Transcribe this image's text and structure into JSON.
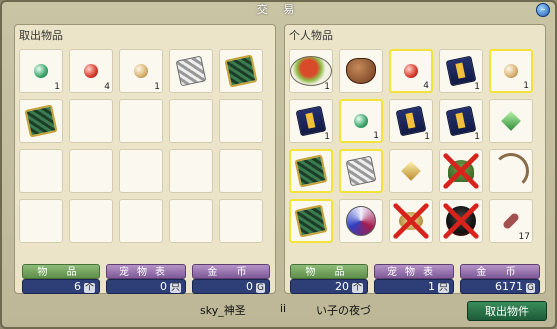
{
  "window": {
    "title": "交 易"
  },
  "left_panel": {
    "title": "取出物品",
    "items": [
      {
        "icon": "green-orb-icon",
        "qty": "1"
      },
      {
        "icon": "red-orb-icon",
        "qty": "4"
      },
      {
        "icon": "tan-orb-icon",
        "qty": "1"
      },
      {
        "icon": "silver-card-icon",
        "qty": ""
      },
      {
        "icon": "green-card-icon",
        "qty": ""
      },
      {
        "icon": "green-card-icon",
        "qty": ""
      }
    ],
    "stats": {
      "items_label": "物 品",
      "items_value": "6",
      "items_unit": "个",
      "pets_label": "宠物表",
      "pets_value": "0",
      "pets_unit": "只",
      "gold_label": "金 币",
      "gold_value": "0",
      "gold_unit": "G"
    },
    "player_name": "sky_神圣"
  },
  "right_panel": {
    "title": "个人物品",
    "items": [
      {
        "icon": "food-dish-icon",
        "qty": "1",
        "hl": false,
        "x": false
      },
      {
        "icon": "chocolate-icon",
        "qty": "",
        "hl": false,
        "x": false
      },
      {
        "icon": "red-orb-icon",
        "qty": "4",
        "hl": true,
        "x": false
      },
      {
        "icon": "blue-card-icon",
        "qty": "1",
        "hl": false,
        "x": false
      },
      {
        "icon": "tan-orb-icon",
        "qty": "1",
        "hl": true,
        "x": false
      },
      {
        "icon": "blue-card-icon",
        "qty": "1",
        "hl": false,
        "x": false
      },
      {
        "icon": "green-orb-icon",
        "qty": "1",
        "hl": true,
        "x": false
      },
      {
        "icon": "blue-card-icon",
        "qty": "1",
        "hl": false,
        "x": false
      },
      {
        "icon": "blue-card-icon",
        "qty": "1",
        "hl": false,
        "x": false
      },
      {
        "icon": "green-gem-icon",
        "qty": "",
        "hl": false,
        "x": false
      },
      {
        "icon": "green-card-icon",
        "qty": "",
        "hl": true,
        "x": false
      },
      {
        "icon": "silver-card-icon",
        "qty": "",
        "hl": true,
        "x": false
      },
      {
        "icon": "gold-gem-icon",
        "qty": "",
        "hl": false,
        "x": false
      },
      {
        "icon": "helmet-icon",
        "qty": "",
        "hl": false,
        "x": true
      },
      {
        "icon": "bow-icon",
        "qty": "",
        "hl": false,
        "x": false
      },
      {
        "icon": "green-card-icon",
        "qty": "",
        "hl": true,
        "x": false
      },
      {
        "icon": "swirl-orb-icon",
        "qty": "",
        "hl": false,
        "x": false
      },
      {
        "icon": "horn-icon",
        "qty": "",
        "hl": false,
        "x": true
      },
      {
        "icon": "dark-shield-icon",
        "qty": "",
        "hl": false,
        "x": true
      },
      {
        "icon": "key-icon",
        "qty": "17",
        "hl": false,
        "x": false
      }
    ],
    "stats": {
      "items_label": "物 品",
      "items_value": "20",
      "items_unit": "个",
      "pets_label": "宠物表",
      "pets_value": "1",
      "pets_unit": "只",
      "gold_label": "金 币",
      "gold_value": "6171",
      "gold_unit": "G"
    },
    "player_name": "い子の夜づ",
    "mid_text": "ii",
    "action_button": "取出物件"
  }
}
